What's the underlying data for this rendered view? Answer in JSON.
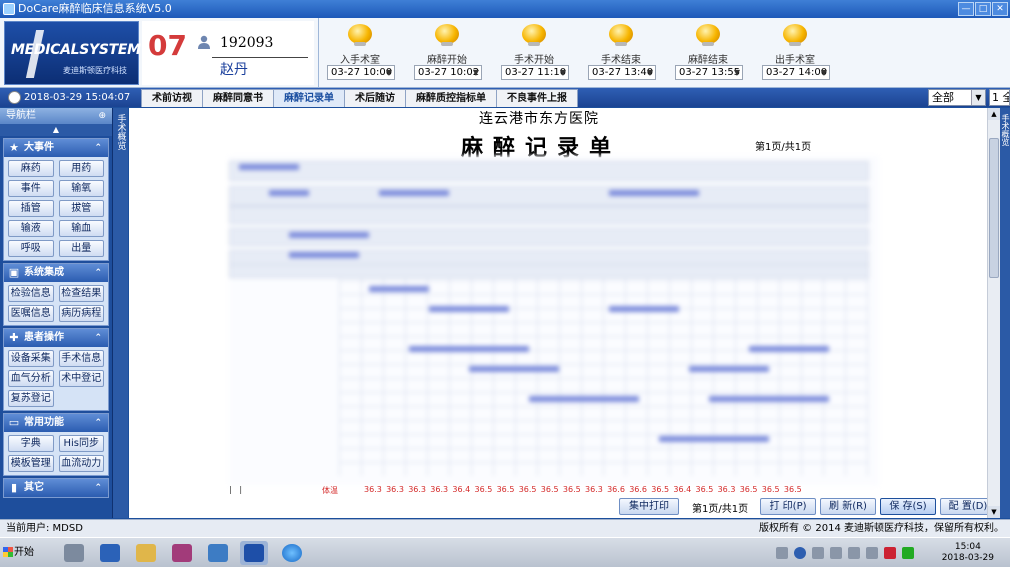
{
  "window": {
    "title": "DoCare麻醉临床信息系统V5.0",
    "controls": [
      "—",
      "□",
      "✕"
    ]
  },
  "logo": {
    "main": "MEDICALSYSTEM",
    "sub": "麦迪斯顿医疗科技"
  },
  "patient": {
    "bed": "07",
    "id": "192093",
    "name": "赵丹"
  },
  "events": [
    {
      "label": "入手术室",
      "time": "03-27 10:00"
    },
    {
      "label": "麻醉开始",
      "time": "03-27 10:02"
    },
    {
      "label": "手术开始",
      "time": "03-27 11:10"
    },
    {
      "label": "手术结束",
      "time": "03-27 13:40"
    },
    {
      "label": "麻醉结束",
      "time": "03-27 13:55"
    },
    {
      "label": "出手术室",
      "time": "03-27 14:00"
    }
  ],
  "clock": "2018-03-29 15:04:07",
  "tabs": [
    {
      "label": "术前访视",
      "active": false
    },
    {
      "label": "麻醉同意书",
      "active": false
    },
    {
      "label": "麻醉记录单",
      "active": true
    },
    {
      "label": "术后随访",
      "active": false
    },
    {
      "label": "麻醉质控指标单",
      "active": false
    },
    {
      "label": "不良事件上报",
      "active": false
    }
  ],
  "filter": {
    "value": "全部",
    "extra": "1 全"
  },
  "sidebar": {
    "title": "导航栏",
    "vertical_label": "手术概览",
    "groups": [
      {
        "title": "大事件",
        "icon": "star-icon",
        "items": [
          "麻药",
          "用药",
          "事件",
          "输氧",
          "插管",
          "拔管",
          "输液",
          "输血",
          "呼吸",
          "出量"
        ]
      },
      {
        "title": "系统集成",
        "icon": "system-icon",
        "items": [
          "检验信息",
          "检查结果",
          "医嘱信息",
          "病历病程"
        ]
      },
      {
        "title": "患者操作",
        "icon": "patient-ops-icon",
        "items": [
          "设备采集",
          "手术信息",
          "血气分析",
          "术中登记",
          "复苏登记"
        ]
      },
      {
        "title": "常用功能",
        "icon": "monitor-icon",
        "items": [
          "字典",
          "His同步",
          "模板管理",
          "血流动力"
        ]
      },
      {
        "title": "其它",
        "icon": "chart-icon",
        "items": []
      }
    ]
  },
  "document": {
    "hospital": "连云港市东方医院",
    "title": "麻醉记录单",
    "page_info": "第1页/共1页",
    "temp_label": "体温",
    "temperatures": [
      "36.3",
      "36.3",
      "36.3",
      "36.3",
      "36.4",
      "36.5",
      "36.5",
      "36.5",
      "36.5",
      "36.5",
      "36.3",
      "36.6",
      "36.6",
      "36.5",
      "36.4",
      "36.5",
      "36.3",
      "36.5",
      "36.5",
      "36.5"
    ]
  },
  "bottom": {
    "print_batch": "集中打印",
    "page_text": "第1页/共1页",
    "print": "打 印(P)",
    "refresh": "刷 新(R)",
    "save": "保 存(S)",
    "config": "配 置(D)"
  },
  "status": {
    "current_user": "当前用户: MDSD",
    "copyright": "版权所有 © 2014 麦迪斯顿医疗科技，保留所有权利。"
  },
  "taskbar": {
    "start": "开始",
    "time": "15:04",
    "date": "2018-03-29"
  },
  "right_tab_label": "手术概览"
}
